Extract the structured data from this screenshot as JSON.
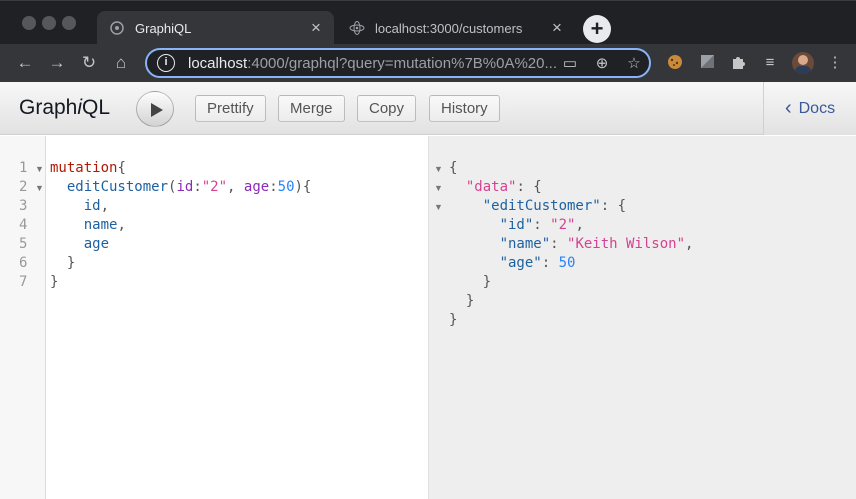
{
  "browser": {
    "tabs": [
      {
        "title": "GraphiQL",
        "active": true,
        "favicon": "graphql-icon"
      },
      {
        "title": "localhost:3000/customers",
        "active": false,
        "favicon": "react-icon"
      }
    ],
    "url_host": "localhost",
    "url_rest": ":4000/graphql?query=mutation%7B%0A%20..."
  },
  "graphiql": {
    "logo_pre": "Graph",
    "logo_i": "i",
    "logo_post": "QL",
    "buttons": {
      "prettify": "Prettify",
      "merge": "Merge",
      "copy": "Copy",
      "history": "History"
    },
    "docs": "Docs"
  },
  "editor": {
    "line_numbers": [
      "1",
      "2",
      "3",
      "4",
      "5",
      "6",
      "7"
    ],
    "line1": {
      "kw": "mutation",
      "brace": "{"
    },
    "line2": {
      "field": "editCustomer",
      "p1": "(",
      "arg1": "id",
      "c1": ":",
      "val1": "\"2\"",
      "comma": ", ",
      "arg2": "age",
      "c2": ":",
      "val2": "50",
      "p2": "){"
    },
    "line3": {
      "field": "id",
      "punc": ","
    },
    "line4": {
      "field": "name",
      "punc": ","
    },
    "line5": {
      "field": "age"
    },
    "line6": "}",
    "line7": "}"
  },
  "result": {
    "open": "{",
    "k_data": "\"data\"",
    "k_edit": "\"editCustomer\"",
    "k_id": "\"id\"",
    "v_id": "\"2\"",
    "k_name": "\"name\"",
    "v_name": "\"Keith Wilson\"",
    "k_age": "\"age\"",
    "v_age": "50",
    "close": "}"
  },
  "colors": {
    "accent": "#8ab4f8",
    "docs_link": "#3b5998",
    "keyword": "#b11a04",
    "field": "#1f61a0",
    "string": "#d64292",
    "number": "#2882f9"
  }
}
